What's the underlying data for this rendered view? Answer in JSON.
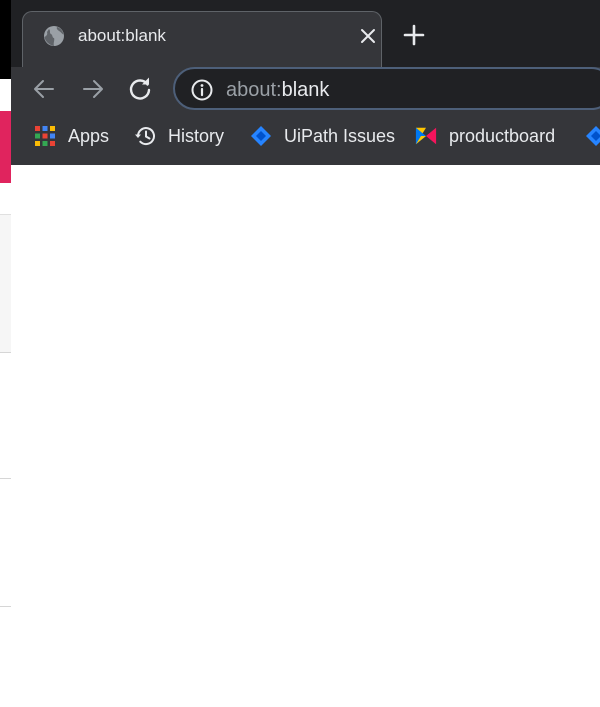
{
  "background_window": {
    "accent_color": "#e0245e"
  },
  "tab": {
    "title": "about:blank",
    "favicon": "globe-icon",
    "close_icon": "close-icon"
  },
  "new_tab": {
    "icon": "plus-icon"
  },
  "toolbar": {
    "back_icon": "arrow-left-icon",
    "forward_icon": "arrow-right-icon",
    "reload_icon": "reload-icon"
  },
  "omnibox": {
    "info_icon": "info-icon",
    "url_scheme": "about:",
    "url_rest": "blank"
  },
  "bookmarks": [
    {
      "label": "Apps",
      "icon": "apps-grid-icon"
    },
    {
      "label": "History",
      "icon": "history-icon"
    },
    {
      "label": "UiPath Issues",
      "icon": "jira-icon"
    },
    {
      "label": "productboard",
      "icon": "productboard-icon"
    }
  ],
  "colors": {
    "titlebar": "#202124",
    "toolbar": "#35363a",
    "text": "#e8eaed",
    "omnibox_border": "#4d5f79"
  }
}
